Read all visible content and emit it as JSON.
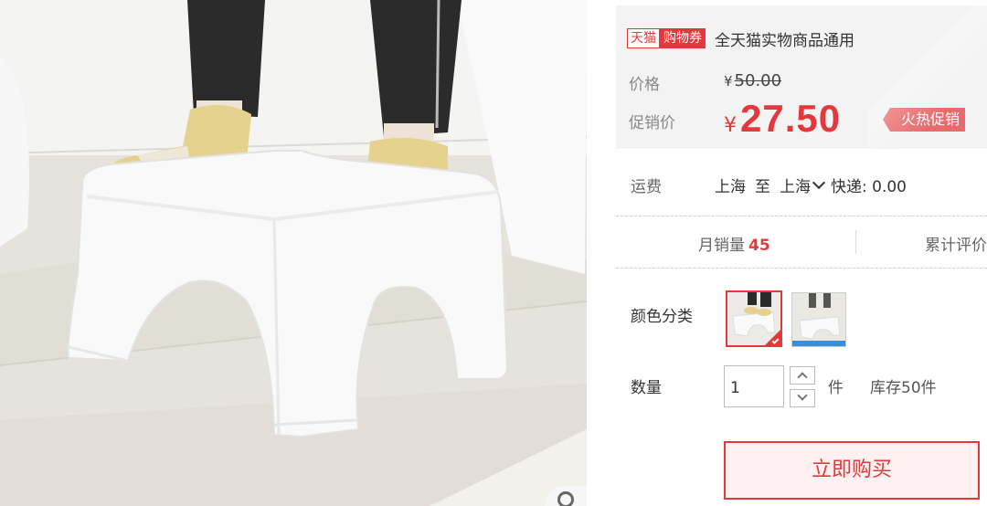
{
  "product_image": {
    "alt": "stool-photo",
    "icon": "zoom-icon"
  },
  "price_box": {
    "tmall_badge": "天猫",
    "coupon_badge": "购物券",
    "coupon_text": "全天猫实物商品通用",
    "price_label": "价格",
    "original_price_currency": "¥",
    "original_price": "50.00",
    "promo_label": "促销价",
    "promo_currency": "¥",
    "promo_price": "27.50",
    "hot_tag": "火热促销"
  },
  "shipping": {
    "label": "运费",
    "from": "上海",
    "to_word": "至",
    "to": "上海",
    "express": "快递: 0.00"
  },
  "stats": {
    "monthly_sales_label": "月销量",
    "monthly_sales_value": "45",
    "reviews_label": "累计评价"
  },
  "options": {
    "color_label": "颜色分类",
    "quantity_label": "数量",
    "quantity_value": "1",
    "unit": "件",
    "stock": "库存50件"
  },
  "buy_button": "立即购买",
  "colors": {
    "accent": "#e4393c",
    "price_box_bg": "#f3f3f3",
    "hot_tag_bg": "#e96a6c"
  }
}
